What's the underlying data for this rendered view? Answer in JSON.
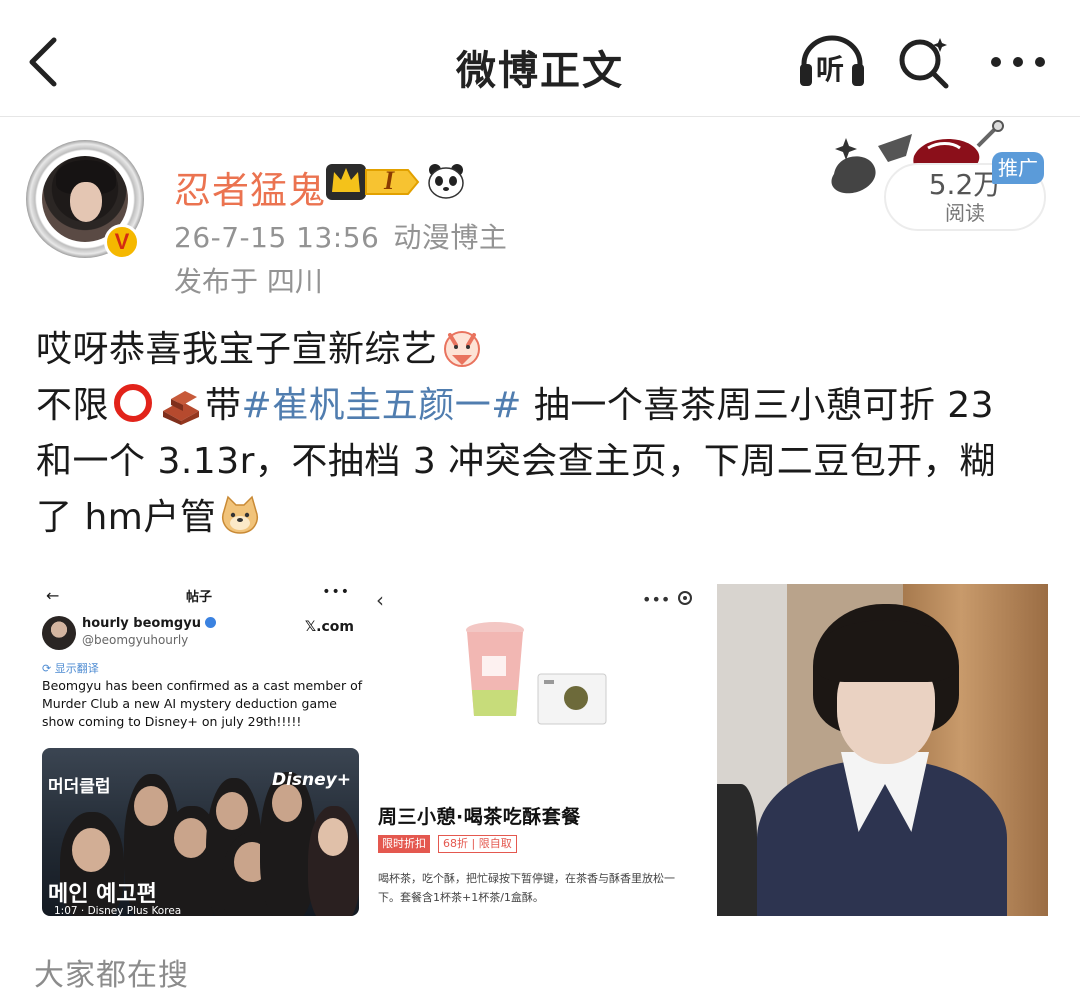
{
  "nav": {
    "title": "微博正文",
    "listen_label": "听"
  },
  "post": {
    "author": "忍者猛鬼",
    "level_badge_text": "I",
    "verified_mark": "V",
    "timestamp": "26-7-15 13:56",
    "author_category": "动漫博主",
    "location": "发布于 四川",
    "read_count": "5.2万",
    "read_label": "阅读",
    "promo_tag": "推广",
    "text": {
      "line1": "哎呀恭喜我宝子宣新综艺",
      "line2_prefix": "不限",
      "line2_mid": "带",
      "hashtag": "#崔杋圭五颜一#",
      "line2_suffix": " 抽一个喜茶周三小憩可折 23",
      "line3": "和一个 3.13r，不抽档 3 冲突会查主页，下周二豆包开，糊",
      "line4": "了 hm户管"
    }
  },
  "images": {
    "tweet": {
      "nav_title": "帖子",
      "name": "hourly beomgyu",
      "handle": "@beomgyuhourly",
      "site": "𝕏.com",
      "translate": "显示翻译",
      "body": "Beomgyu has been confirmed as a cast member of Murder Club a new AI mystery deduction game show coming to Disney+ on july 29th!!!!!",
      "video_top_text": "머더클럽",
      "video_brand": "Disney+",
      "video_main_text": "메인 예고편",
      "video_caption": "1:07 · Disney Plus Korea"
    },
    "tea": {
      "title": "周三小憩·喝茶吃酥套餐",
      "tag_red": "限时折扣",
      "tag_outline": "68折 | 限自取",
      "description": "喝杯茶，吃个酥，把忙碌按下暂停键，在茶香与酥香里放松一下。套餐含1杯茶+1杯茶/1盒酥。"
    }
  },
  "section": {
    "title": "大家都在搜"
  },
  "colors": {
    "username": "#eb7350",
    "hashtag": "#507daf",
    "meta": "#939393",
    "promo": "#5b9bd9"
  }
}
